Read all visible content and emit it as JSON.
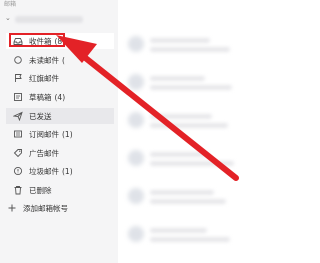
{
  "sidebar": {
    "section_label": "邮箱",
    "account_chevron": "⌄",
    "items": [
      {
        "label": "收件箱",
        "count": "(89)",
        "icon": "inbox-icon"
      },
      {
        "label": "未读邮件",
        "count": "(",
        "icon": "unread-icon"
      },
      {
        "label": "红旗邮件",
        "count": "",
        "icon": "flag-icon"
      },
      {
        "label": "草稿箱",
        "count": "(4)",
        "icon": "drafts-icon"
      },
      {
        "label": "已发送",
        "count": "",
        "icon": "sent-icon"
      },
      {
        "label": "订阅邮件",
        "count": "(1)",
        "icon": "subscription-icon"
      },
      {
        "label": "广告邮件",
        "count": "",
        "icon": "ad-tag-icon"
      },
      {
        "label": "垃圾邮件",
        "count": "(1)",
        "icon": "spam-icon"
      },
      {
        "label": "已删除",
        "count": "",
        "icon": "trash-icon"
      }
    ],
    "add_account": {
      "label": "添加邮箱帐号",
      "icon": "plus-icon"
    }
  },
  "annotation": {
    "color": "#e32227"
  }
}
